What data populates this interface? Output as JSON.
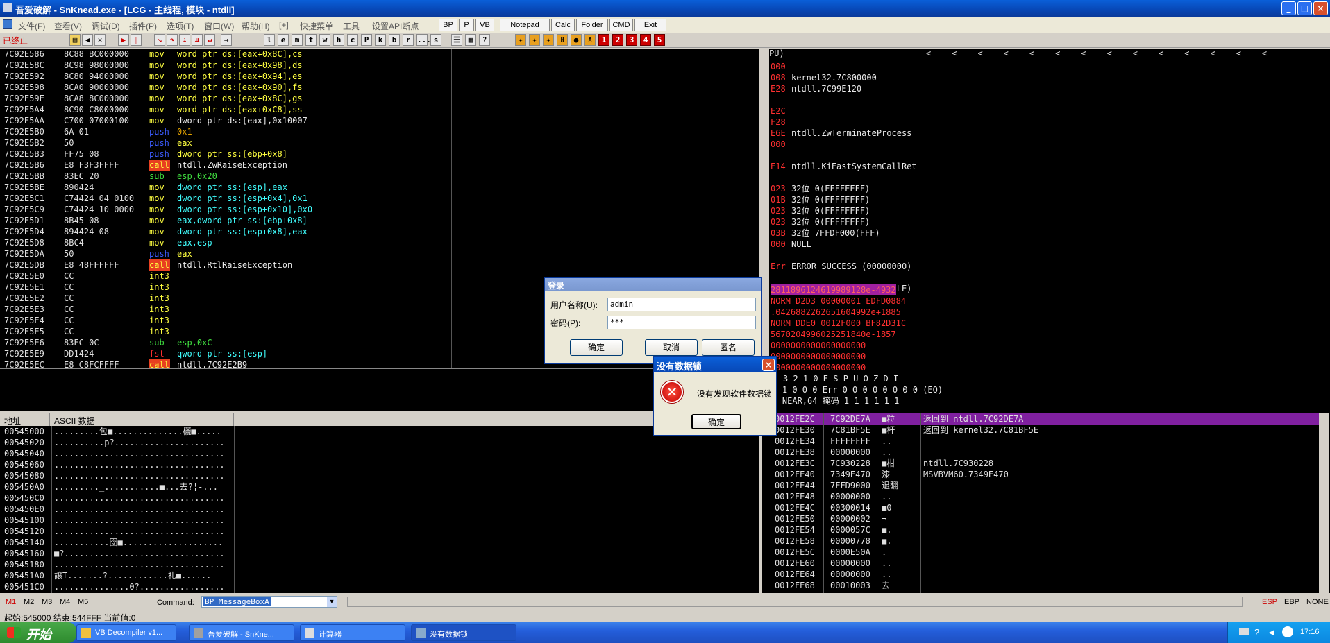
{
  "window": {
    "title": "吾爱破解 - SnKnead.exe - [LCG - 主线程, 模块 - ntdll]",
    "minimize": "_",
    "maximize": "□",
    "close": "×"
  },
  "menu": {
    "items": [
      "文件(F)",
      "查看(V)",
      "调试(D)",
      "插件(P)",
      "选项(T)",
      "窗口(W)",
      "帮助(H)",
      "[+]",
      "快捷菜单",
      "工具",
      "设置API断点"
    ],
    "buttons": [
      "BP",
      "P",
      "VB",
      "Notepad",
      "Calc",
      "Folder",
      "CMD",
      "Exit"
    ]
  },
  "toolbar": {
    "status": "已终止",
    "letters": [
      "l",
      "e",
      "m",
      "t",
      "w",
      "h",
      "c",
      "P",
      "k",
      "b",
      "r",
      "...",
      "s"
    ],
    "numbered": [
      "1",
      "2",
      "3",
      "4",
      "5"
    ]
  },
  "disasm": {
    "rows": [
      {
        "addr": "7C92E586",
        "hex": "8C88 BC000000",
        "op": "mov",
        "args": "word ptr ds:[eax+0x8C],cs",
        "kind": "mov"
      },
      {
        "addr": "7C92E58C",
        "hex": "8C98 98000000",
        "op": "mov",
        "args": "word ptr ds:[eax+0x98],ds",
        "kind": "mov"
      },
      {
        "addr": "7C92E592",
        "hex": "8C80 94000000",
        "op": "mov",
        "args": "word ptr ds:[eax+0x94],es",
        "kind": "mov"
      },
      {
        "addr": "7C92E598",
        "hex": "8CA0 90000000",
        "op": "mov",
        "args": "word ptr ds:[eax+0x90],fs",
        "kind": "mov"
      },
      {
        "addr": "7C92E59E",
        "hex": "8CA8 8C000000",
        "op": "mov",
        "args": "word ptr ds:[eax+0x8C],gs",
        "kind": "mov"
      },
      {
        "addr": "7C92E5A4",
        "hex": "8C90 C8000000",
        "op": "mov",
        "args": "word ptr ds:[eax+0xC8],ss",
        "kind": "mov"
      },
      {
        "addr": "7C92E5AA",
        "hex": "C700 07000100",
        "op": "mov",
        "args": "dword ptr ds:[eax],0x10007",
        "kind": "movw"
      },
      {
        "addr": "7C92E5B0",
        "hex": "6A 01",
        "op": "push",
        "args": "0x1",
        "kind": "pushn"
      },
      {
        "addr": "7C92E5B2",
        "hex": "50",
        "op": "push",
        "args": "eax",
        "kind": "push"
      },
      {
        "addr": "7C92E5B3",
        "hex": "FF75 08",
        "op": "push",
        "args": "dword ptr ss:[ebp+0x8]",
        "kind": "push"
      },
      {
        "addr": "7C92E5B6",
        "hex": "E8 F3F3FFFF",
        "op": "call",
        "args": "ntdll.ZwRaiseException",
        "kind": "call"
      },
      {
        "addr": "7C92E5BB",
        "hex": "83EC 20",
        "op": "sub",
        "args": "esp,0x20",
        "kind": "sub"
      },
      {
        "addr": "7C92E5BE",
        "hex": "890424",
        "op": "mov",
        "args": "dword ptr ss:[esp],eax",
        "kind": "movg"
      },
      {
        "addr": "7C92E5C1",
        "hex": "C74424 04 0100",
        "op": "mov",
        "args": "dword ptr ss:[esp+0x4],0x1",
        "kind": "movg"
      },
      {
        "addr": "7C92E5C9",
        "hex": "C74424 10 0000",
        "op": "mov",
        "args": "dword ptr ss:[esp+0x10],0x0",
        "kind": "movg"
      },
      {
        "addr": "7C92E5D1",
        "hex": "8B45 08",
        "op": "mov",
        "args": "eax,dword ptr ss:[ebp+0x8]",
        "kind": "movg"
      },
      {
        "addr": "7C92E5D4",
        "hex": "894424 08",
        "op": "mov",
        "args": "dword ptr ss:[esp+0x8],eax",
        "kind": "movg"
      },
      {
        "addr": "7C92E5D8",
        "hex": "8BC4",
        "op": "mov",
        "args": "eax,esp",
        "kind": "movg"
      },
      {
        "addr": "7C92E5DA",
        "hex": "50",
        "op": "push",
        "args": "eax",
        "kind": "push"
      },
      {
        "addr": "7C92E5DB",
        "hex": "E8 48FFFFFF",
        "op": "call",
        "args": "ntdll.RtlRaiseException",
        "kind": "call"
      },
      {
        "addr": "7C92E5E0",
        "hex": "CC",
        "op": "int3",
        "args": "",
        "kind": "int3"
      },
      {
        "addr": "7C92E5E1",
        "hex": "CC",
        "op": "int3",
        "args": "",
        "kind": "int3"
      },
      {
        "addr": "7C92E5E2",
        "hex": "CC",
        "op": "int3",
        "args": "",
        "kind": "int3"
      },
      {
        "addr": "7C92E5E3",
        "hex": "CC",
        "op": "int3",
        "args": "",
        "kind": "int3"
      },
      {
        "addr": "7C92E5E4",
        "hex": "CC",
        "op": "int3",
        "args": "",
        "kind": "int3"
      },
      {
        "addr": "7C92E5E5",
        "hex": "CC",
        "op": "int3",
        "args": "",
        "kind": "int3"
      },
      {
        "addr": "7C92E5E6",
        "hex": "83EC 0C",
        "op": "sub",
        "args": "esp,0xC",
        "kind": "sub"
      },
      {
        "addr": "7C92E5E9",
        "hex": "DD1424",
        "op": "fst",
        "args": "qword ptr ss:[esp]",
        "kind": "fst"
      },
      {
        "addr": "7C92E5EC",
        "hex": "E8 C8FCFFFF",
        "op": "call",
        "args": "ntdll.7C92E2B9",
        "kind": "call"
      }
    ]
  },
  "registers": {
    "header": "PU)",
    "lines": [
      {
        "a": "000",
        "b": ""
      },
      {
        "a": "008",
        "b": "kernel32.7C800000"
      },
      {
        "a": "E28",
        "b": "ntdll.7C99E120"
      },
      {
        "a": "",
        "b": ""
      },
      {
        "a": "E2C",
        "b": ""
      },
      {
        "a": "F28",
        "b": ""
      },
      {
        "a": "E6E",
        "b": "ntdll.ZwTerminateProcess"
      },
      {
        "a": "000",
        "b": ""
      },
      {
        "a": "",
        "b": ""
      },
      {
        "a": "E14",
        "b": "ntdll.KiFastSystemCallRet"
      },
      {
        "a": "",
        "b": ""
      },
      {
        "a": "023",
        "b": "32位 0(FFFFFFFF)"
      },
      {
        "a": "01B",
        "b": "32位 0(FFFFFFFF)"
      },
      {
        "a": "023",
        "b": "32位 0(FFFFFFFF)"
      },
      {
        "a": "023",
        "b": "32位 0(FFFFFFFF)"
      },
      {
        "a": "03B",
        "b": "32位 7FFDF000(FFF)"
      },
      {
        "a": "000",
        "b": "NULL"
      },
      {
        "a": "",
        "b": ""
      },
      {
        "a": "Err",
        "b": "ERROR_SUCCESS (00000000)"
      },
      {
        "a": "",
        "b": ""
      },
      {
        "a": "246",
        "b": "(NO,NB,E,BE,NS,PE,GE,LE)"
      }
    ],
    "fpu": [
      "2811896124619989128e-4932",
      "NORM D2D3 00000001 EDFD0884",
      ".0426882262651604992e+1885",
      "NORM DDE0 0012F000 BF82D31C",
      "5670204996025251840e-1857",
      "0000000000000000000",
      "0000000000000000000",
      "0000000000000000000"
    ],
    "flags_header": "3 2 1 0      E S P U O Z D I",
    "cond": "ond 1 0 0 0  Err 0 0 0 0 0 0 0 0  (EQ)",
    "prec": "rec NEAR,64  掩码    1 1 1 1 1 1"
  },
  "dump": {
    "col_addr": "地址",
    "col_ascii": "ASCII 数据",
    "rows": [
      {
        "addr": "00545000",
        "ascii": ".........包■..............欐■....."
      },
      {
        "addr": "00545020",
        "ascii": "..........p?......................"
      },
      {
        "addr": "00545040",
        "ascii": ".................................."
      },
      {
        "addr": "00545060",
        "ascii": ".................................."
      },
      {
        "addr": "00545080",
        "ascii": ".................................."
      },
      {
        "addr": "005450A0",
        "ascii": "........._...........■...去?¦-..."
      },
      {
        "addr": "005450C0",
        "ascii": ".................................."
      },
      {
        "addr": "005450E0",
        "ascii": ".................................."
      },
      {
        "addr": "00545100",
        "ascii": ".................................."
      },
      {
        "addr": "00545120",
        "ascii": ".................................."
      },
      {
        "addr": "00545140",
        "ascii": "...........囹■...................."
      },
      {
        "addr": "00545160",
        "ascii": "■?................................"
      },
      {
        "addr": "00545180",
        "ascii": ".................................."
      },
      {
        "addr": "005451A0",
        "ascii": "譲T.......?............礼■......"
      },
      {
        "addr": "005451C0",
        "ascii": "...............0?................."
      }
    ]
  },
  "stack": {
    "rows": [
      {
        "addr": "0012FE2C",
        "val": "7C92DE7A",
        "ch": "■粒",
        "cm": "返回到 ntdll.7C92DE7A",
        "hl": true
      },
      {
        "addr": "0012FE30",
        "val": "7C81BF5E",
        "ch": "■杆",
        "cm": "返回到 kernel32.7C81BF5E",
        "hl": false
      },
      {
        "addr": "0012FE34",
        "val": "FFFFFFFF",
        "ch": "..",
        "cm": "",
        "hl": false
      },
      {
        "addr": "0012FE38",
        "val": "00000000",
        "ch": "..",
        "cm": "",
        "hl": false
      },
      {
        "addr": "0012FE3C",
        "val": "7C930228",
        "ch": "■柑",
        "cm": "ntdll.7C930228",
        "hl": false
      },
      {
        "addr": "0012FE40",
        "val": "7349E470",
        "ch": "  漆",
        "cm": "MSVBVM60.7349E470",
        "hl": false
      },
      {
        "addr": "0012FE44",
        "val": "7FFD9000",
        "ch": "退翻",
        "cm": "",
        "hl": false
      },
      {
        "addr": "0012FE48",
        "val": "00000000",
        "ch": "..",
        "cm": "",
        "hl": false
      },
      {
        "addr": "0012FE4C",
        "val": "00300014",
        "ch": "■0",
        "cm": "",
        "hl": false
      },
      {
        "addr": "0012FE50",
        "val": "00000002",
        "ch": "¬",
        "cm": "",
        "hl": false
      },
      {
        "addr": "0012FE54",
        "val": "0000057C",
        "ch": "■.",
        "cm": "",
        "hl": false
      },
      {
        "addr": "0012FE58",
        "val": "00000778",
        "ch": "■.",
        "cm": "",
        "hl": false
      },
      {
        "addr": "0012FE5C",
        "val": "0000E50A",
        "ch": "  .",
        "cm": "",
        "hl": false
      },
      {
        "addr": "0012FE60",
        "val": "00000000",
        "ch": "..",
        "cm": "",
        "hl": false
      },
      {
        "addr": "0012FE64",
        "val": "00000000",
        "ch": "..",
        "cm": "",
        "hl": false
      },
      {
        "addr": "0012FE68",
        "val": "00010003",
        "ch": " 去",
        "cm": "",
        "hl": false
      }
    ]
  },
  "command": {
    "markers": [
      "M1",
      "M2",
      "M3",
      "M4",
      "M5"
    ],
    "label": "Command:",
    "value": "BP  MessageBoxA",
    "regs": [
      "ESP",
      "EBP",
      "NONE"
    ]
  },
  "statusbar": "起始:545000 结束:544FFF 当前值:0",
  "login_dialog": {
    "title": "登录",
    "user_label": "用户名称(U):",
    "user_value": "admin",
    "pass_label": "密码(P):",
    "pass_value": "***",
    "ok": "确定",
    "cancel": "取消",
    "anon": "匿名"
  },
  "msg_dialog": {
    "title": "没有数据锁",
    "text": "没有发现软件数据锁",
    "ok": "确定",
    "close": "×",
    "icon": "error-icon"
  },
  "taskbar": {
    "start": "开始",
    "tasks": [
      "VB Decompiler v1...",
      "吾爱破解 - SnKne...",
      "计算器",
      "没有数据锁"
    ],
    "clock": "17:16"
  }
}
